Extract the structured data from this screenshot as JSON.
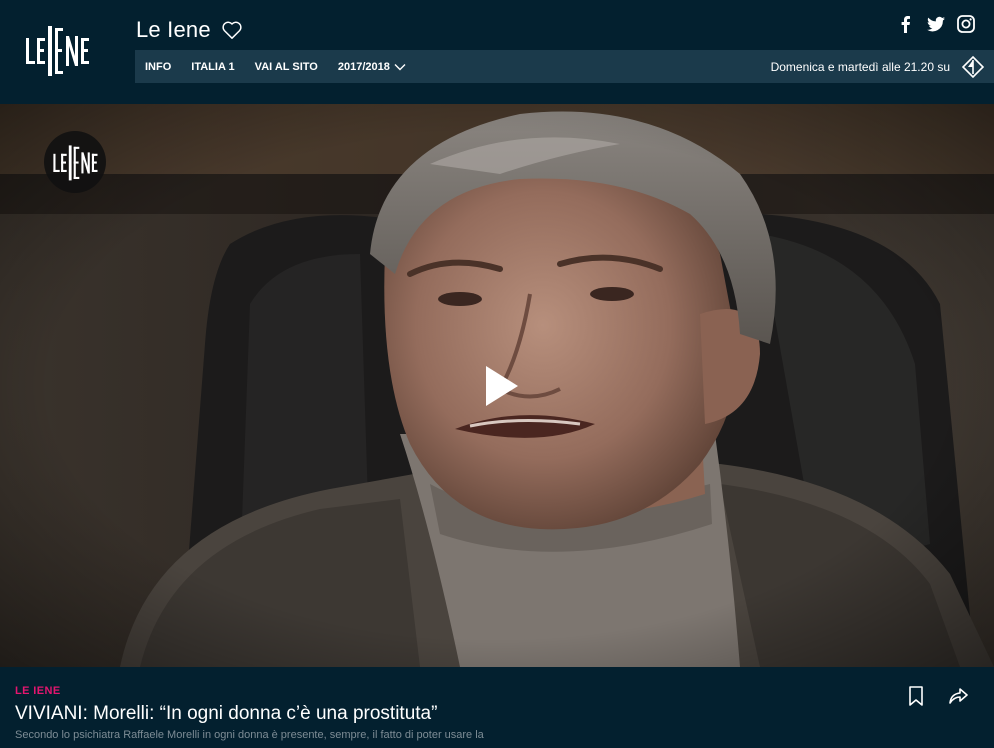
{
  "header": {
    "brand_title": "Le Iene",
    "logo_text": "LE IENE",
    "favorite_icon": "heart-outline-icon",
    "social": [
      {
        "name": "facebook",
        "icon": "facebook-icon"
      },
      {
        "name": "twitter",
        "icon": "twitter-icon"
      },
      {
        "name": "instagram",
        "icon": "instagram-icon"
      }
    ]
  },
  "nav": {
    "items": [
      {
        "label": "INFO"
      },
      {
        "label": "ITALIA 1"
      },
      {
        "label": "VAI AL SITO"
      },
      {
        "label": "2017/2018",
        "has_dropdown": true
      }
    ],
    "schedule": "Domenica e martedì alle 21.20 su",
    "channel_icon": "italia1-logo-icon"
  },
  "video": {
    "overlay_logo_text": "LE IENE",
    "play_icon": "play-icon"
  },
  "article": {
    "category": "LE IENE",
    "headline": "VIVIANI: Morelli: “In ogni donna c’è una prostituta”",
    "summary": "Secondo lo psichiatra Raffaele Morelli in ogni donna è presente, sempre, il fatto di poter usare la",
    "bookmark_icon": "bookmark-icon",
    "share_icon": "share-icon"
  },
  "colors": {
    "background": "#03202f",
    "nav_bar": "#1b3a4b",
    "accent": "#e4166f",
    "summary_text": "#7d8c95"
  }
}
